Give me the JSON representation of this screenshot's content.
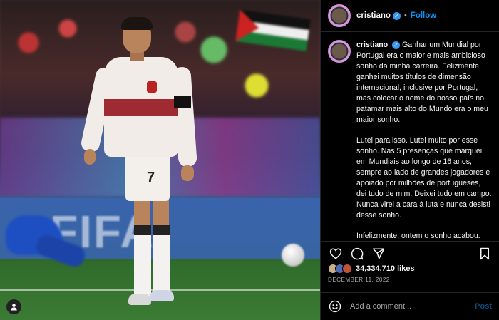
{
  "post": {
    "username": "cristiano",
    "follow_label": "Follow",
    "dot": "•",
    "caption_paragraphs": [
      "Ganhar um Mundial por Portugal era o maior e mais ambicioso sonho da minha carreira. Felizmente ganhei muitos títulos de dimensão internacional, inclusive por Portugal, mas colocar o nome do nosso país no patamar mais alto do Mundo era o meu maior sonho.",
      "Lutei para isso. Lutei muito por esse sonho. Nas 5 presenças que marquei em Mundiais ao longo de 16 anos, sempre ao lado de grandes jogadores e apoiado por milhões de portugueses, dei tudo de mim. Deixei tudo em campo. Nunca virei a cara à luta e nunca desisti desse sonho.",
      "Infelizmente, ontem o sonho acabou. Não vale a pena reagir a quente."
    ],
    "likes": "34,334,710 likes",
    "date": "DECEMBER 11, 2022",
    "photo_number": "7"
  },
  "comment": {
    "placeholder": "Add a comment...",
    "post_label": "Post"
  },
  "icons": {
    "like": "heart-icon",
    "comment": "comment-icon",
    "share": "send-icon",
    "save": "bookmark-icon",
    "emoji": "emoji-icon",
    "tag": "user-tag-icon"
  },
  "colors": {
    "accent": "#0095f6",
    "verified": "#3897f0",
    "background": "#000000"
  }
}
